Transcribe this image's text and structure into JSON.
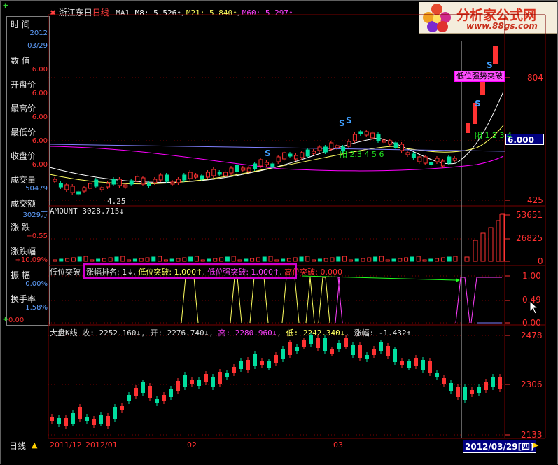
{
  "logo": {
    "brand_text": "分析家公式网",
    "url_text": "www.88gs.com"
  },
  "main_title": {
    "stock_name": "浙江东日",
    "period": "日线",
    "ma_label": "MA1",
    "m8": "M8: 5.526↑",
    "m21": "M21: 5.840↑",
    "m60": "M60: 5.297↑"
  },
  "info_panel": {
    "items": [
      {
        "label": "时  间",
        "value": "2012"
      },
      {
        "label": "",
        "value": "03/29"
      },
      {
        "label": "数  值",
        "value": "6.00"
      },
      {
        "label": "开盘价",
        "value": "6.00"
      },
      {
        "label": "最高价",
        "value": "6.00"
      },
      {
        "label": "最低价",
        "value": "6.00"
      },
      {
        "label": "收盘价",
        "value": "6.00"
      },
      {
        "label": "成交量",
        "value": "50479"
      },
      {
        "label": "成交额",
        "value": "3029万"
      },
      {
        "label": "涨  跌",
        "value": "+0.55"
      },
      {
        "label": "涨跌幅",
        "value": "+10.09%"
      },
      {
        "label": "振  幅",
        "value": "0.00%"
      },
      {
        "label": "换手率",
        "value": "1.58%"
      },
      {
        "label": "",
        "value": "0.00"
      }
    ]
  },
  "price_axis": {
    "top_label": "804",
    "current_price": "6.000",
    "bottom_label": "425",
    "low_marker": "4.25",
    "signal_labels": [
      "S",
      "S",
      "S",
      "S",
      "S"
    ],
    "yang_label_1": "阳 2.3 4 5 6",
    "yang_label_2": "阳 1 2 3 4"
  },
  "callout_text": "低位强势突破",
  "volume": {
    "title": "AMOUNT 3028.715↓",
    "axis": [
      "53651",
      "26825",
      "0"
    ]
  },
  "indicator": {
    "title_prefix": "低位突破",
    "rank": "涨幅排名: 1↓",
    "breakout": "低位突破: 1.000↑",
    "strong_breakout": "低位强突破: 1.000↑",
    "high_breakout": "高位突破: 0.000",
    "axis": [
      "1.00",
      "0.49",
      "0.00"
    ]
  },
  "index_panel": {
    "title": "大盘K线",
    "close": "收: 2252.160↓",
    "open": "开: 2276.740↓",
    "high": "高: 2280.960↓",
    "low": "低: 2242.340↓",
    "change": "涨幅: -1.432↑",
    "axis": [
      "2478",
      "2306",
      "2133"
    ]
  },
  "bottom_bar": {
    "period": "日线",
    "dates": [
      "2011/12",
      "2012/01",
      "02",
      "03"
    ],
    "current_date": "2012/03/29",
    "weekday": "四"
  },
  "colors": {
    "up": "#ff3232",
    "down": "#00e0a0",
    "grid": "#7a0000",
    "ma_white": "#ffffff",
    "ma_yellow": "#ffff60",
    "ma_magenta": "#ff00ff"
  }
}
